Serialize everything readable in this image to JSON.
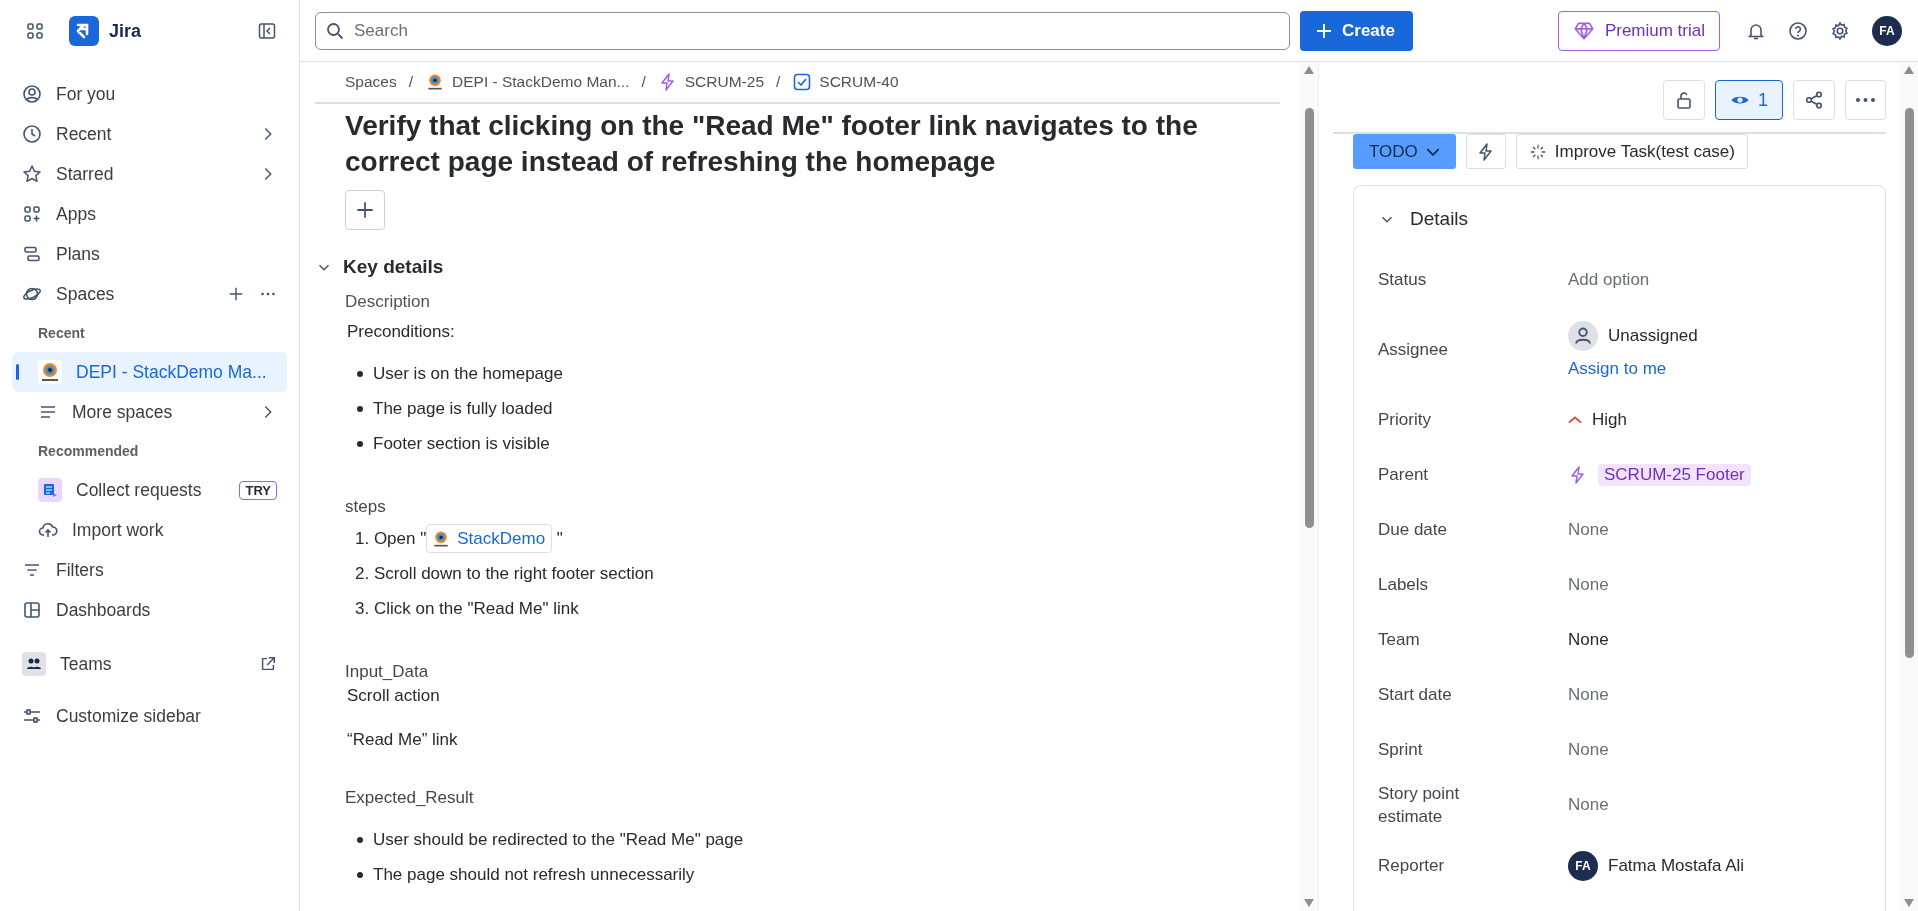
{
  "topbar": {
    "app_name": "Jira",
    "search_placeholder": "Search",
    "create_label": "Create",
    "premium_label": "Premium trial",
    "avatar": "FA"
  },
  "sidebar": {
    "items": [
      {
        "kind": "nav",
        "label": "For you",
        "expandable": false,
        "selected": false
      },
      {
        "kind": "nav",
        "label": "Recent",
        "expandable": true,
        "selected": false
      },
      {
        "kind": "nav",
        "label": "Starred",
        "expandable": true,
        "selected": false
      },
      {
        "kind": "nav",
        "label": "Apps",
        "expandable": false,
        "selected": false
      },
      {
        "kind": "nav",
        "label": "Plans",
        "expandable": false,
        "selected": false
      },
      {
        "kind": "section",
        "label": "Spaces",
        "expandable": false,
        "selected": false
      },
      {
        "kind": "heading",
        "label": "Recent"
      },
      {
        "kind": "space",
        "label": "DEPI - StackDemo Ma...",
        "expandable": false,
        "selected": true
      },
      {
        "kind": "sub",
        "label": "More spaces",
        "expandable": true,
        "selected": false
      },
      {
        "kind": "heading",
        "label": "Recommended"
      },
      {
        "kind": "sub",
        "label": "Collect requests",
        "badge": "TRY",
        "expandable": false,
        "selected": false
      },
      {
        "kind": "sub",
        "label": "Import work",
        "expandable": false,
        "selected": false
      },
      {
        "kind": "nav",
        "label": "Filters",
        "expandable": false,
        "selected": false
      },
      {
        "kind": "nav",
        "label": "Dashboards",
        "expandable": false,
        "selected": false
      },
      {
        "kind": "team",
        "label": "Teams",
        "expandable": false,
        "selected": false
      },
      {
        "kind": "nav",
        "label": "Customize sidebar",
        "expandable": false,
        "selected": false
      }
    ]
  },
  "breadcrumb_separator": "/",
  "breadcrumb": [
    {
      "kind": "text",
      "label": "Spaces"
    },
    {
      "kind": "space",
      "label": "DEPI - StackDemo Man..."
    },
    {
      "kind": "epic",
      "label": "SCRUM-25"
    },
    {
      "kind": "task",
      "label": "SCRUM-40"
    }
  ],
  "issue": {
    "title": "Verify that clicking on the \"Read Me\" footer link navigates to the correct page instead of refreshing the homepage",
    "key_details": {
      "heading": "Key details",
      "expanded": true,
      "description_label": "Description",
      "blocks": [
        {
          "kind": "para",
          "text": "Preconditions:"
        },
        {
          "kind": "bullets",
          "items": [
            "User is on the homepage",
            "The page is fully loaded",
            "Footer section is visible"
          ]
        },
        {
          "kind": "heading",
          "text": "steps"
        },
        {
          "kind": "steps",
          "items": [
            {
              "text": "1. Open \"",
              "link": "StackDemo",
              "after": " \""
            },
            {
              "text": "2. Scroll down to the right footer section"
            },
            {
              "text": "3. Click on the \"Read Me\" link"
            }
          ]
        },
        {
          "kind": "heading",
          "text": "Input_Data"
        },
        {
          "kind": "para",
          "text": "Scroll action"
        },
        {
          "kind": "para",
          "text": "“Read Me” link"
        },
        {
          "kind": "heading",
          "text": "Expected_Result"
        },
        {
          "kind": "bullets",
          "items": [
            "User should be redirected to the \"Read Me\" page",
            "The page should not refresh unnecessarily"
          ]
        }
      ]
    }
  },
  "side_panel": {
    "watch": {
      "count": "1",
      "on": true
    },
    "status_label": "TODO",
    "improve_label": "Improve Task(test case)",
    "details": {
      "heading": "Details",
      "expanded": true,
      "fields": [
        {
          "label": "Status",
          "kind": "empty",
          "value": "Add option"
        },
        {
          "label": "Assignee",
          "kind": "user",
          "value": "Unassigned",
          "action": "Assign to me"
        },
        {
          "label": "Priority",
          "kind": "priority",
          "value": "High"
        },
        {
          "label": "Parent",
          "kind": "parent",
          "value": "SCRUM-25 Footer"
        },
        {
          "label": "Due date",
          "kind": "empty",
          "value": "None"
        },
        {
          "label": "Labels",
          "kind": "empty",
          "value": "None"
        },
        {
          "label": "Team",
          "kind": "text",
          "value": "None"
        },
        {
          "label": "Start date",
          "kind": "empty",
          "value": "None"
        },
        {
          "label": "Sprint",
          "kind": "empty",
          "value": "None"
        },
        {
          "label": "Story point estimate",
          "kind": "empty",
          "value": "None"
        },
        {
          "label": "Reporter",
          "kind": "reporter",
          "value": "Fatma Mostafa Ali",
          "avatar": "FA"
        }
      ]
    }
  }
}
